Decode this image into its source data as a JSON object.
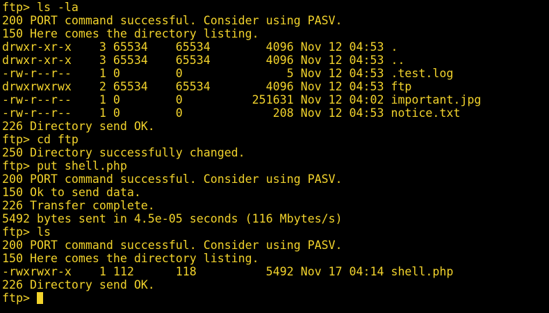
{
  "colors": {
    "background": "#000000",
    "foreground": "#f2d32c"
  },
  "terminal": {
    "lines": [
      "ftp> ls -la",
      "200 PORT command successful. Consider using PASV.",
      "150 Here comes the directory listing.",
      "drwxr-xr-x    3 65534    65534        4096 Nov 12 04:53 .",
      "drwxr-xr-x    3 65534    65534        4096 Nov 12 04:53 ..",
      "-rw-r--r--    1 0        0               5 Nov 12 04:53 .test.log",
      "drwxrwxrwx    2 65534    65534        4096 Nov 12 04:53 ftp",
      "-rw-r--r--    1 0        0          251631 Nov 12 04:02 important.jpg",
      "-rw-r--r--    1 0        0             208 Nov 12 04:53 notice.txt",
      "226 Directory send OK.",
      "ftp> cd ftp",
      "250 Directory successfully changed.",
      "ftp> put shell.php",
      "200 PORT command successful. Consider using PASV.",
      "150 Ok to send data.",
      "226 Transfer complete.",
      "5492 bytes sent in 4.5e-05 seconds (116 Mbytes/s)",
      "ftp> ls",
      "200 PORT command successful. Consider using PASV.",
      "150 Here comes the directory listing.",
      "-rwxrwxr-x    1 112      118          5492 Nov 17 04:14 shell.php",
      "226 Directory send OK."
    ],
    "prompt": "ftp> "
  }
}
